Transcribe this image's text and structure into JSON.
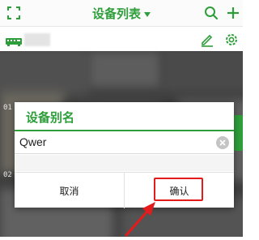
{
  "header": {
    "title": "设备列表",
    "icons": {
      "left": "fullscreen-icon",
      "title_dropdown": "triangle-down-icon",
      "search": "search-icon",
      "add": "plus-icon"
    }
  },
  "subbar": {
    "icons": {
      "device": "device-icon",
      "edit": "pencil-icon",
      "settings": "gear-icon"
    }
  },
  "background_labels": {
    "left_number": "01",
    "left_number_2": "02"
  },
  "dialog": {
    "title": "设备别名",
    "input_value": "Qwer",
    "cancel_label": "取消",
    "confirm_label": "确认"
  },
  "colors": {
    "accent": "#2e9e3a",
    "highlight": "#e41b1b"
  }
}
